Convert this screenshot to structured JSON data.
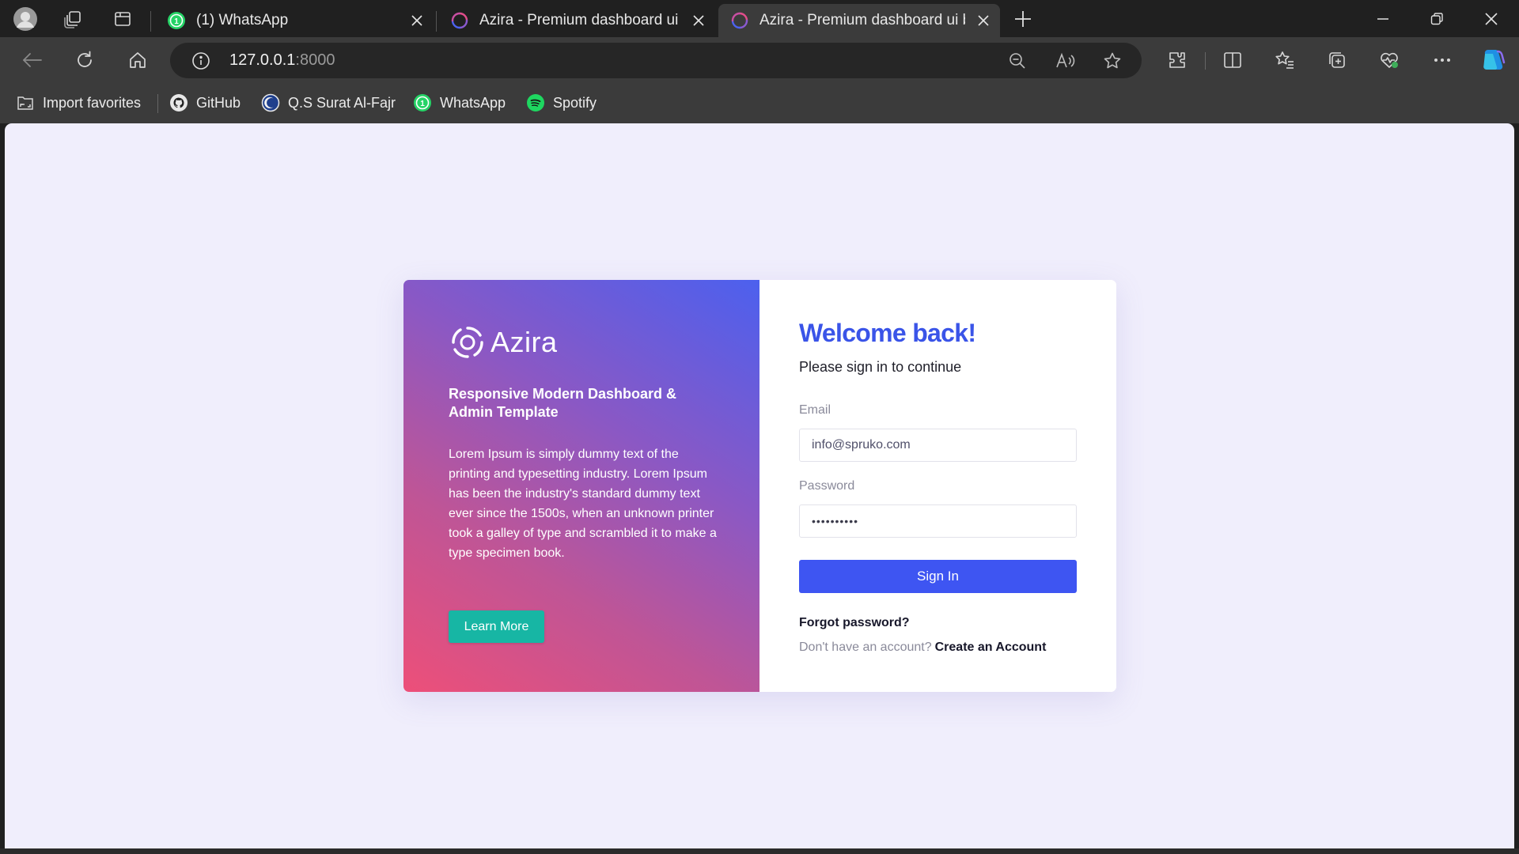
{
  "browser": {
    "tabs": [
      {
        "title": "(1) WhatsApp",
        "favicon": "whatsapp-icon",
        "badge": "1",
        "active": false
      },
      {
        "title": "Azira - Premium dashboard ui bootstrap",
        "favicon": "azira-icon",
        "active": false
      },
      {
        "title": "Azira - Premium dashboard ui bootstrap",
        "favicon": "azira-icon",
        "active": true
      }
    ],
    "address": {
      "host": "127.0.0.1",
      "port": ":8000"
    },
    "bookmarks": [
      {
        "label": "Import favorites",
        "icon": "import-icon"
      },
      {
        "label": "GitHub",
        "icon": "github-icon"
      },
      {
        "label": "Q.S Surat Al-Fajr",
        "icon": "quran-icon"
      },
      {
        "label": "WhatsApp",
        "icon": "whatsapp-icon",
        "badge": "1"
      },
      {
        "label": "Spotify",
        "icon": "spotify-icon"
      }
    ]
  },
  "login": {
    "brand": "Azira",
    "tagline": "Responsive Modern Dashboard & Admin Template",
    "description": "Lorem Ipsum is simply dummy text of the printing and typesetting industry. Lorem Ipsum has been the industry's standard dummy text ever since the 1500s, when an unknown printer took a galley of type and scrambled it to make a type specimen book.",
    "learn_more": "Learn More",
    "welcome": "Welcome back!",
    "subtitle": "Please sign in to continue",
    "email_label": "Email",
    "email_value": "info@spruko.com",
    "password_label": "Password",
    "password_value": "••••••••••",
    "sign_in": "Sign In",
    "forgot": "Forgot password?",
    "no_account": "Don't have an account?",
    "create_account": "Create an Account"
  },
  "colors": {
    "accent": "#3e55f2",
    "welcome": "#3a54e8",
    "learn_more": "#17b6a4",
    "page_bg": "#f0eefc",
    "gradient_start": "#ed4f79",
    "gradient_end": "#4c60ee"
  }
}
